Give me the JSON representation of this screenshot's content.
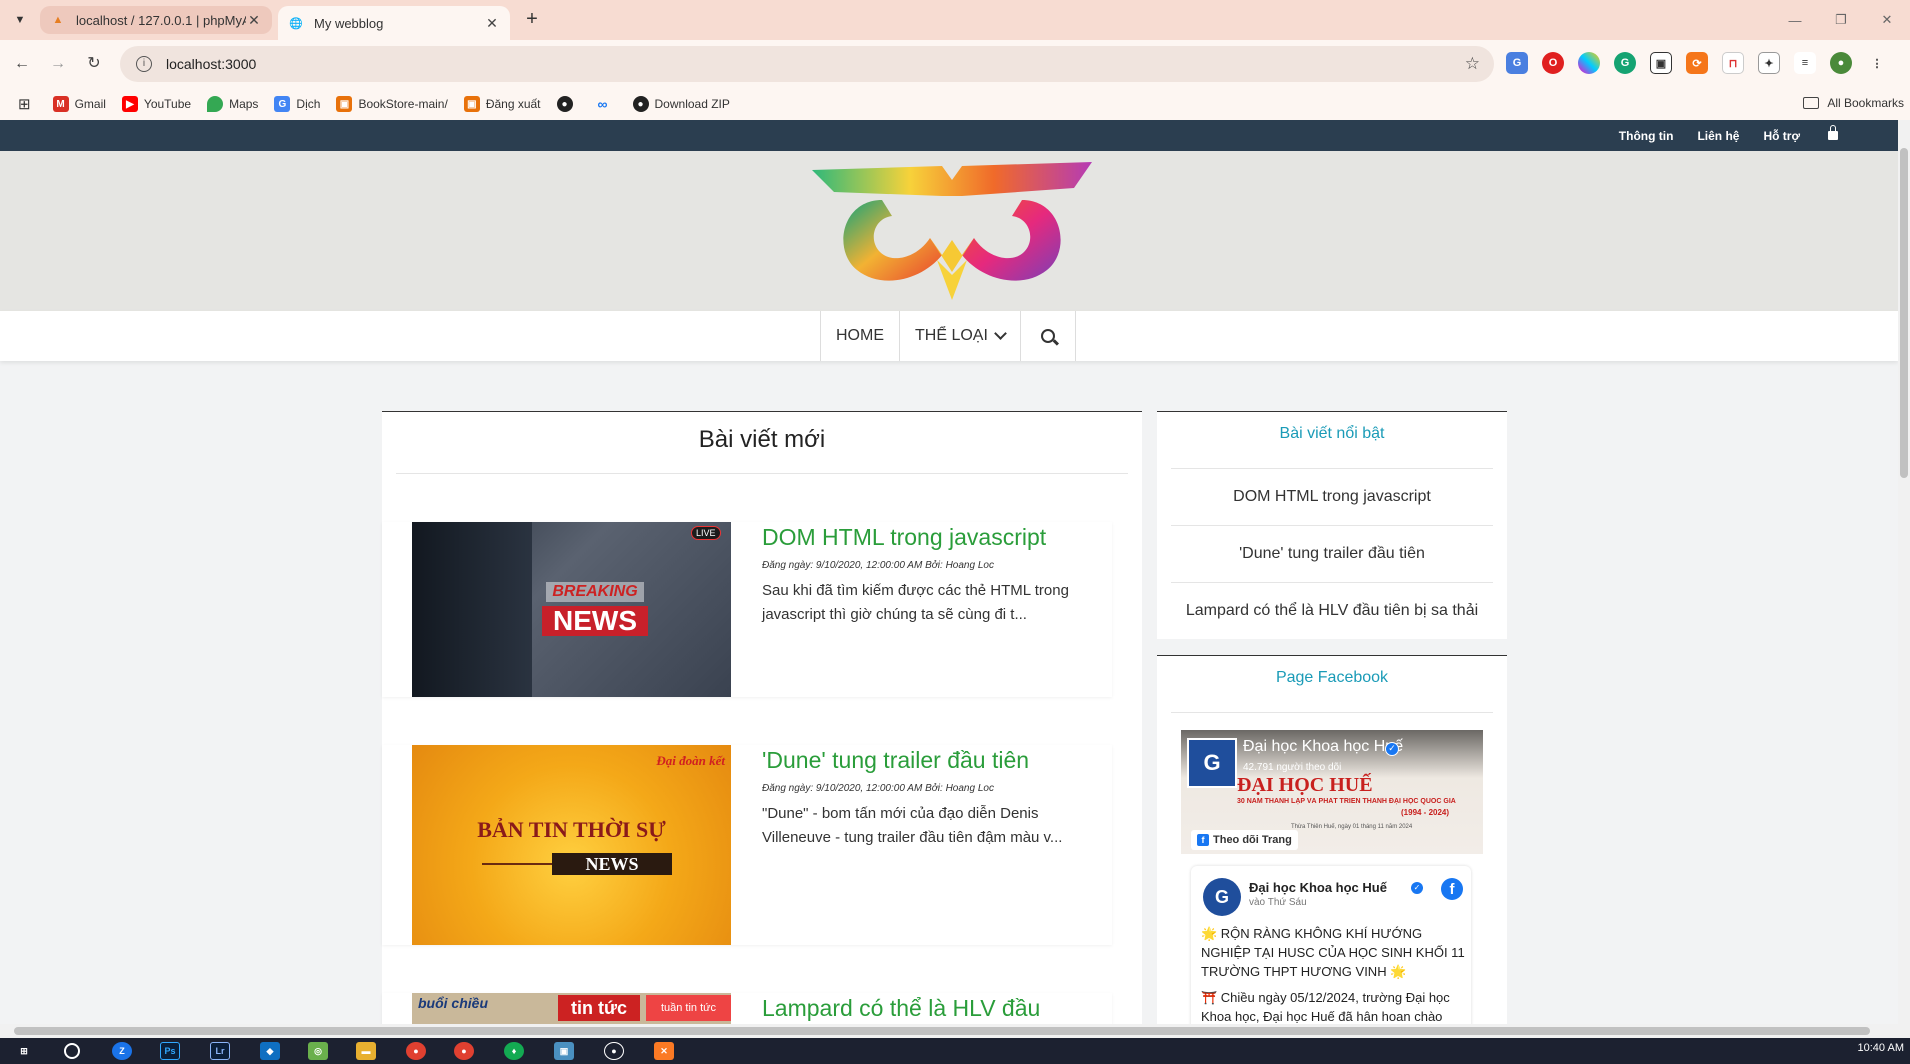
{
  "browser": {
    "tabs": [
      {
        "title": "localhost / 127.0.0.1 | phpMyAdmin",
        "active": false
      },
      {
        "title": "My webblog",
        "active": true
      }
    ],
    "url": "localhost:3000",
    "bookmarks": [
      {
        "label": "Gmail",
        "icon": "gmail-icon",
        "color": "#d93025"
      },
      {
        "label": "YouTube",
        "icon": "youtube-icon",
        "color": "#ff0000"
      },
      {
        "label": "Maps",
        "icon": "maps-icon",
        "color": "#34a853"
      },
      {
        "label": "Dịch",
        "icon": "translate-icon",
        "color": "#4285f4"
      },
      {
        "label": "BookStore-main/",
        "icon": "bookstore-icon",
        "color": "#e8710a"
      },
      {
        "label": "Đăng xuất",
        "icon": "logout-icon",
        "color": "#e8710a"
      },
      {
        "label": "",
        "icon": "github-icon",
        "color": "#222222"
      },
      {
        "label": "",
        "icon": "meta-icon",
        "color": "#1877f2"
      },
      {
        "label": "Download ZIP",
        "icon": "github-icon",
        "color": "#222222"
      }
    ],
    "all_bookmarks_label": "All Bookmarks",
    "clock": "10:40 AM"
  },
  "site": {
    "topbar_links": [
      "Thông tin",
      "Liên hệ",
      "Hỗ trợ"
    ],
    "nav": {
      "home": "HOME",
      "categories": "THỂ LOẠI"
    },
    "main": {
      "title": "Bài viết mới",
      "posts": [
        {
          "title": "DOM HTML trong javascript",
          "meta": "Đăng ngày: 9/10/2020, 12:00:00 AM Bởi: Hoang Loc",
          "excerpt": "Sau khi đã tìm kiếm được các thẻ HTML trong javascript thì giờ chúng ta sẽ cùng đi t...",
          "image_text": [
            "BREAKING",
            "NEWS",
            "LIVE"
          ]
        },
        {
          "title": "'Dune' tung trailer đầu tiên",
          "meta": "Đăng ngày: 9/10/2020, 12:00:00 AM Bởi: Hoang Loc",
          "excerpt": "\"Dune\" - bom tấn mới của đạo diễn Denis Villeneuve - tung trailer đầu tiên đậm màu v...",
          "image_text": [
            "Đại đoàn kết",
            "BẢN TIN THỜI SỰ",
            "NEWS"
          ]
        },
        {
          "title": "Lampard có thể là HLV đầu",
          "meta": "",
          "excerpt": "",
          "image_text": [
            "buổi chiều",
            "tin tức",
            "tuần tin tức"
          ]
        }
      ]
    },
    "sidebar": {
      "featured_title": "Bài viết nổi bật",
      "featured_items": [
        "DOM HTML trong javascript",
        "'Dune' tung trailer đầu tiên",
        "Lampard có thể là HLV đầu tiên bị sa thải"
      ],
      "facebook_title": "Page Facebook",
      "fb_page": {
        "name": "Đại học Khoa học Huế",
        "followers": "42.791 người theo dõi",
        "follow_label": "Theo dõi Trang",
        "cover_line1": "ĐẠI HỌC HUẾ",
        "cover_line2": "30 NĂM THÀNH LẬP VÀ PHÁT TRIỂN THÀNH ĐẠI HỌC QUỐC GIA",
        "cover_line3": "(1994 - 2024)",
        "cover_line4": "Thừa Thiên Huế, ngày 01 tháng 11 năm 2024",
        "post_time": "vào Thứ Sáu",
        "post_text1": "🌟 RỘN RÀNG KHÔNG KHÍ HƯỚNG NGHIỆP TẠI HUSC CỦA HỌC SINH KHỐI 11 TRƯỜNG THPT HƯƠNG VINH 🌟",
        "post_text2": "⛩️ Chiều ngày 05/12/2024, trường Đại học Khoa học, Đại học Huế đã hân hoan chào"
      }
    }
  },
  "colors": {
    "topbar": "#2b3e50",
    "accent_green": "#2a9d3a",
    "accent_teal": "#1a9bb7"
  }
}
